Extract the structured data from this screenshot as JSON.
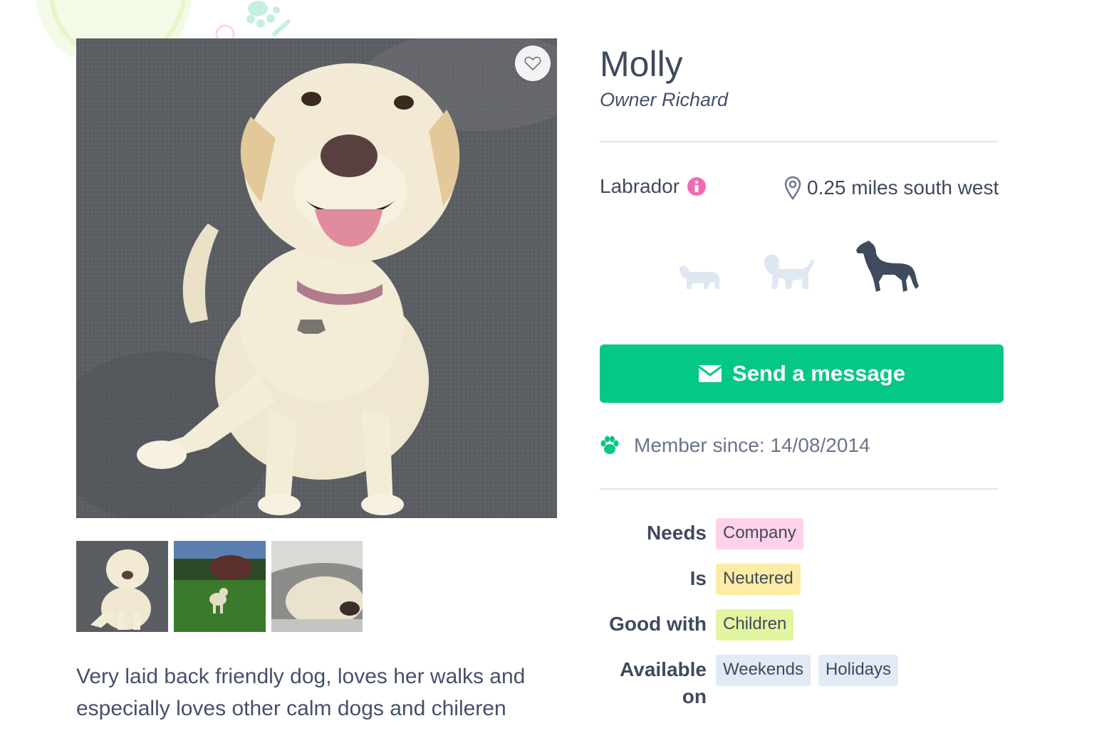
{
  "profile": {
    "name": "Molly",
    "owner": "Owner Richard",
    "breed": "Labrador",
    "distance": "0.25 miles south west",
    "description": "Very laid back friendly dog, loves her walks and especially loves other calm dogs and chileren",
    "member_since": "Member since: 14/08/2014"
  },
  "size_options": [
    {
      "name": "small-dog-icon",
      "selected": false
    },
    {
      "name": "medium-dog-icon",
      "selected": false
    },
    {
      "name": "large-dog-icon",
      "selected": true
    }
  ],
  "actions": {
    "send_message": "Send a message"
  },
  "attributes": {
    "needs": {
      "label": "Needs",
      "tags": [
        "Company"
      ]
    },
    "is": {
      "label": "Is",
      "tags": [
        "Neutered"
      ]
    },
    "good_with": {
      "label": "Good with",
      "tags": [
        "Children"
      ]
    },
    "available_on": {
      "label": "Available on",
      "tags": [
        "Weekends",
        "Holidays"
      ]
    }
  },
  "colors": {
    "primary_green": "#05c787",
    "text_dark": "#3f4a5c",
    "tag_pink": "#ffd2ea",
    "tag_yellow": "#fdeca5",
    "tag_green": "#e2f5a1",
    "tag_blue": "#e2eaf5",
    "info_pink": "#f06ab5",
    "size_inactive": "#dfe7f2",
    "size_active": "#3f4a5c"
  },
  "icons": [
    "heart-icon",
    "info-icon",
    "map-pin-icon",
    "envelope-icon",
    "paw-icon"
  ]
}
